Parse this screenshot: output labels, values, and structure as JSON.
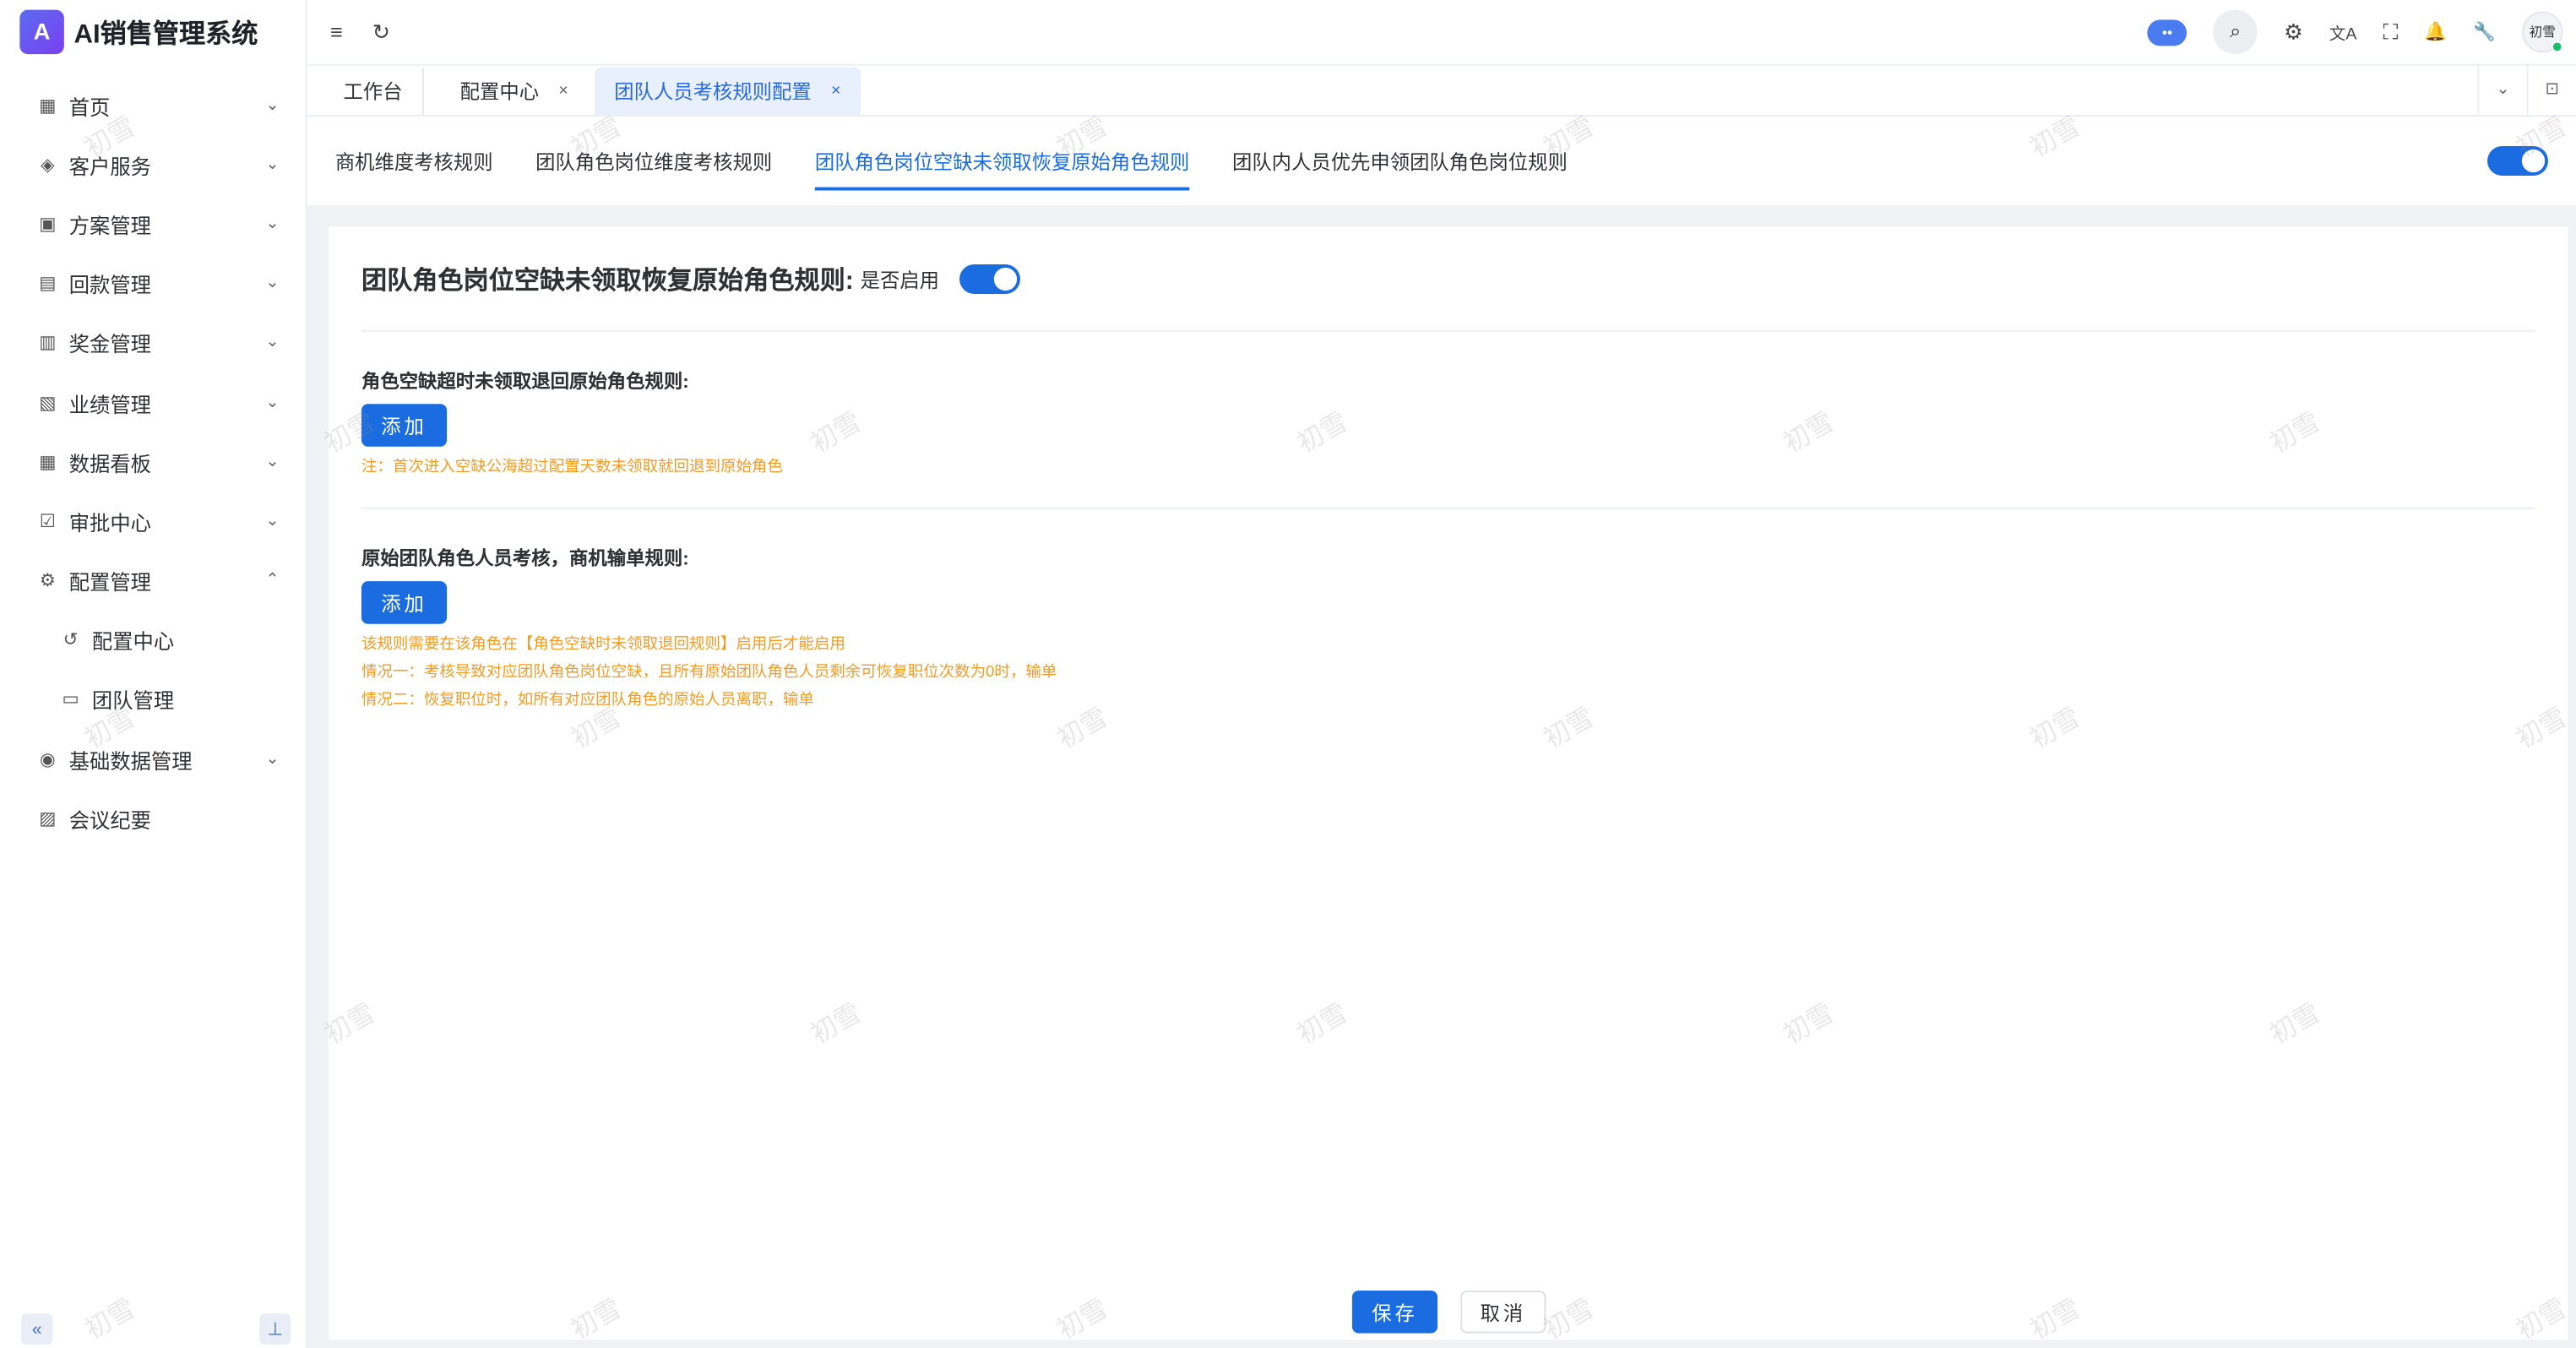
{
  "app": {
    "title": "AI销售管理系统",
    "logo_letter": "A"
  },
  "sidebar": {
    "items": [
      {
        "label": "首页",
        "icon": "grid-icon",
        "glyph": "▦",
        "arrow": "⌄"
      },
      {
        "label": "客户服务",
        "icon": "customer-icon",
        "glyph": "◈",
        "arrow": "⌄"
      },
      {
        "label": "方案管理",
        "icon": "plan-icon",
        "glyph": "▣",
        "arrow": "⌄"
      },
      {
        "label": "回款管理",
        "icon": "payment-icon",
        "glyph": "▤",
        "arrow": "⌄"
      },
      {
        "label": "奖金管理",
        "icon": "bonus-icon",
        "glyph": "▥",
        "arrow": "⌄"
      },
      {
        "label": "业绩管理",
        "icon": "chart-icon",
        "glyph": "▧",
        "arrow": "⌄"
      },
      {
        "label": "数据看板",
        "icon": "dashboard-icon",
        "glyph": "▦",
        "arrow": "⌄"
      },
      {
        "label": "审批中心",
        "icon": "approval-icon",
        "glyph": "☑",
        "arrow": "⌄"
      },
      {
        "label": "配置管理",
        "icon": "gear-icon",
        "glyph": "⚙",
        "arrow": "⌃"
      },
      {
        "label": "配置中心",
        "icon": "config-center-icon",
        "glyph": "↺",
        "arrow": ""
      },
      {
        "label": "团队管理",
        "icon": "monitor-icon",
        "glyph": "▭",
        "arrow": ""
      },
      {
        "label": "基础数据管理",
        "icon": "database-icon",
        "glyph": "◉",
        "arrow": "⌄"
      },
      {
        "label": "会议纪要",
        "icon": "meeting-icon",
        "glyph": "▨",
        "arrow": ""
      }
    ],
    "collapse_glyph": "«",
    "pin_glyph": "⊥"
  },
  "topbar": {
    "menu_glyph": "≡",
    "refresh_glyph": "↻",
    "robot_glyph": "••",
    "search_glyph": "⌕",
    "settings_glyph": "⚙",
    "translate_glyph": "文A",
    "fullscreen_glyph": "⛶",
    "bell_glyph": "🔔",
    "wrench_glyph": "🔧",
    "avatar_text": "初雪"
  },
  "tabs": [
    {
      "label": "工作台",
      "closable": false
    },
    {
      "label": "配置中心",
      "closable": true,
      "close": "×"
    },
    {
      "label": "团队人员考核规则配置",
      "closable": true,
      "close": "×"
    }
  ],
  "tabs_right": {
    "dropdown_glyph": "⌄",
    "screen_glyph": "⊡"
  },
  "subtabs": [
    "商机维度考核规则",
    "团队角色岗位维度考核规则",
    "团队角色岗位空缺未领取恢复原始角色规则",
    "团队内人员优先申领团队角色岗位规则"
  ],
  "rule": {
    "title": "团队角色岗位空缺未领取恢复原始角色规则:",
    "enable_label": "是否启用",
    "section1": {
      "title": "角色空缺超时未领取退回原始角色规则:",
      "add_label": "添加",
      "note": "注：首次进入空缺公海超过配置天数未领取就回退到原始角色"
    },
    "section2": {
      "title": "原始团队角色人员考核，商机输单规则:",
      "add_label": "添加",
      "notes": [
        "该规则需要在该角色在【角色空缺时未领取退回规则】启用后才能启用",
        "情况一：考核导致对应团队角色岗位空缺，且所有原始团队角色人员剩余可恢复职位次数为0时，输单",
        "情况二：恢复职位时，如所有对应团队角色的原始人员离职，输单"
      ]
    }
  },
  "footer": {
    "save_label": "保存",
    "cancel_label": "取消"
  },
  "watermark_text": "初雪",
  "colors": {
    "accent": "#1a6ce0",
    "note": "#f29b24",
    "active_tab_bg": "#e8f0fe"
  }
}
